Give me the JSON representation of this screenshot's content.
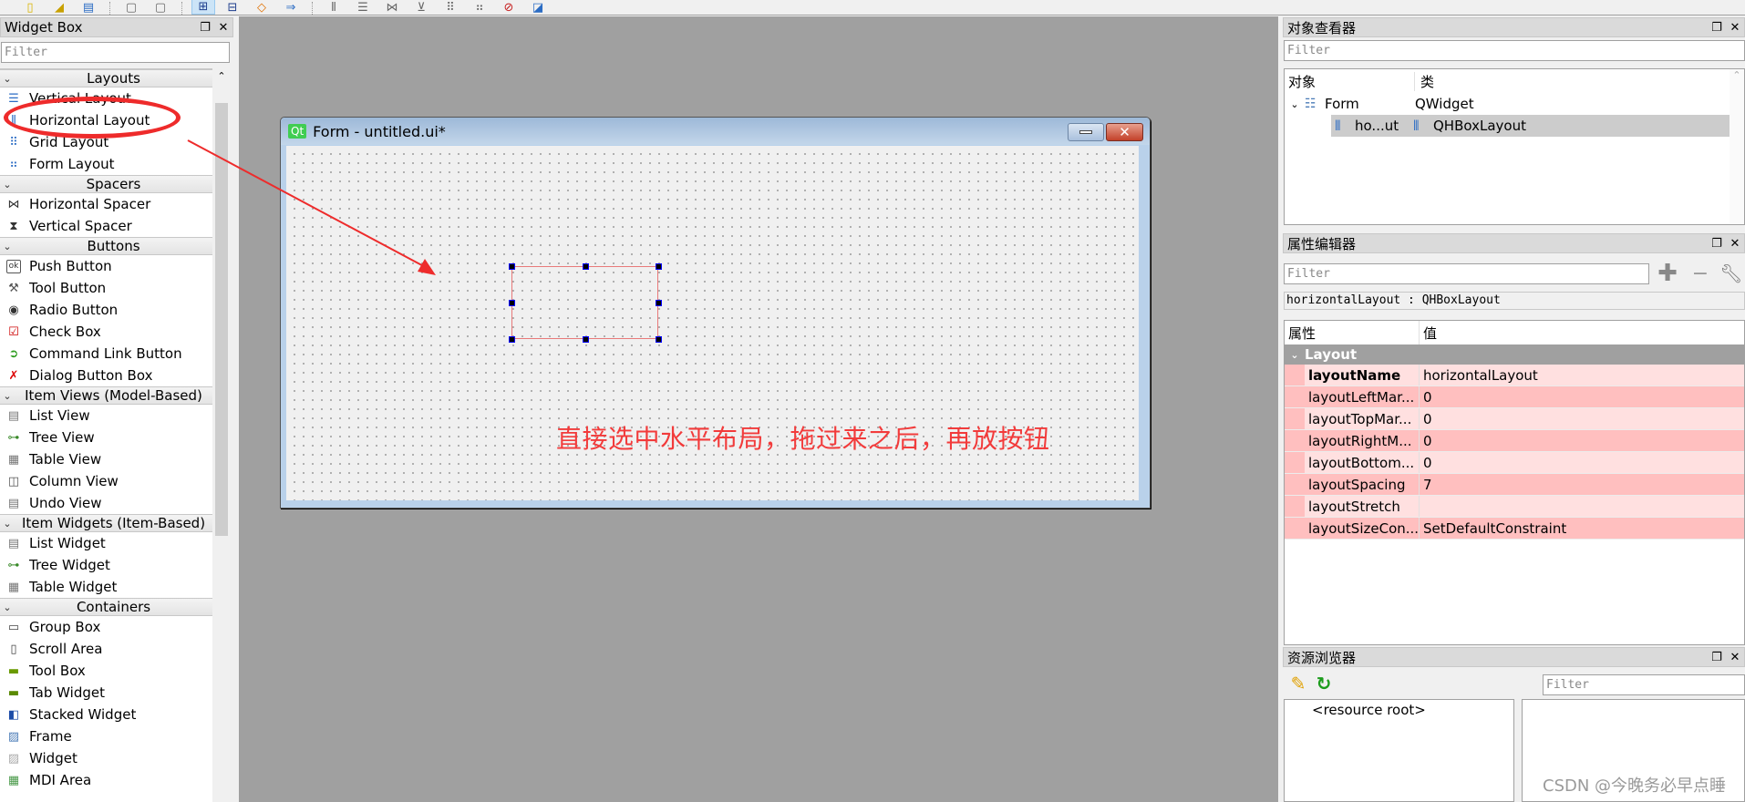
{
  "toolbar": {
    "buttons": [
      "new-file",
      "open-file",
      "save-file",
      "cut",
      "copy",
      "edit-widgets",
      "edit-signals",
      "edit-buddies",
      "edit-tab-order",
      "layout-horizontal",
      "layout-vertical",
      "layout-h-splitter",
      "layout-v-splitter",
      "layout-grid",
      "layout-form",
      "break-layout",
      "adjust-size"
    ]
  },
  "widget_box": {
    "title": "Widget Box",
    "filter_placeholder": "Filter",
    "categories": [
      {
        "label": "Layouts",
        "items": [
          "Vertical Layout",
          "Horizontal Layout",
          "Grid Layout",
          "Form Layout"
        ]
      },
      {
        "label": "Spacers",
        "items": [
          "Horizontal Spacer",
          "Vertical Spacer"
        ]
      },
      {
        "label": "Buttons",
        "items": [
          "Push Button",
          "Tool Button",
          "Radio Button",
          "Check Box",
          "Command Link Button",
          "Dialog Button Box"
        ]
      },
      {
        "label": "Item Views (Model-Based)",
        "items": [
          "List View",
          "Tree View",
          "Table View",
          "Column View",
          "Undo View"
        ]
      },
      {
        "label": "Item Widgets (Item-Based)",
        "items": [
          "List Widget",
          "Tree Widget",
          "Table Widget"
        ]
      },
      {
        "label": "Containers",
        "items": [
          "Group Box",
          "Scroll Area",
          "Tool Box",
          "Tab Widget",
          "Stacked Widget",
          "Frame",
          "Widget",
          "MDI Area"
        ]
      }
    ]
  },
  "form": {
    "logo": "Qt",
    "title": "Form - untitled.ui*",
    "annotation": "直接选中水平布局，拖过来之后，再放按钮",
    "close_glyph": "✕",
    "annotation_color": "#f23b3b"
  },
  "object_inspector": {
    "title": "对象查看器",
    "filter_placeholder": "Filter",
    "col_object": "对象",
    "col_class": "类",
    "rows": [
      {
        "name": "Form",
        "class": "QWidget"
      },
      {
        "name": "ho...ut",
        "class": "QHBoxLayout"
      }
    ]
  },
  "property_editor": {
    "title": "属性编辑器",
    "filter_placeholder": "Filter",
    "object_label": "horizontalLayout : QHBoxLayout",
    "col_property": "属性",
    "col_value": "值",
    "group": "Layout",
    "rows": [
      {
        "key": "layoutName",
        "value": "horizontalLayout"
      },
      {
        "key": "layoutLeftMar...",
        "value": "0"
      },
      {
        "key": "layoutTopMar...",
        "value": "0"
      },
      {
        "key": "layoutRightM...",
        "value": "0"
      },
      {
        "key": "layoutBottom...",
        "value": "0"
      },
      {
        "key": "layoutSpacing",
        "value": "7"
      },
      {
        "key": "layoutStretch",
        "value": ""
      },
      {
        "key": "layoutSizeCon...",
        "value": "SetDefaultConstraint"
      }
    ]
  },
  "resource_browser": {
    "title": "资源浏览器",
    "filter_placeholder": "Filter",
    "root": "<resource root>"
  },
  "watermark": "CSDN @今晚务必早点睡"
}
